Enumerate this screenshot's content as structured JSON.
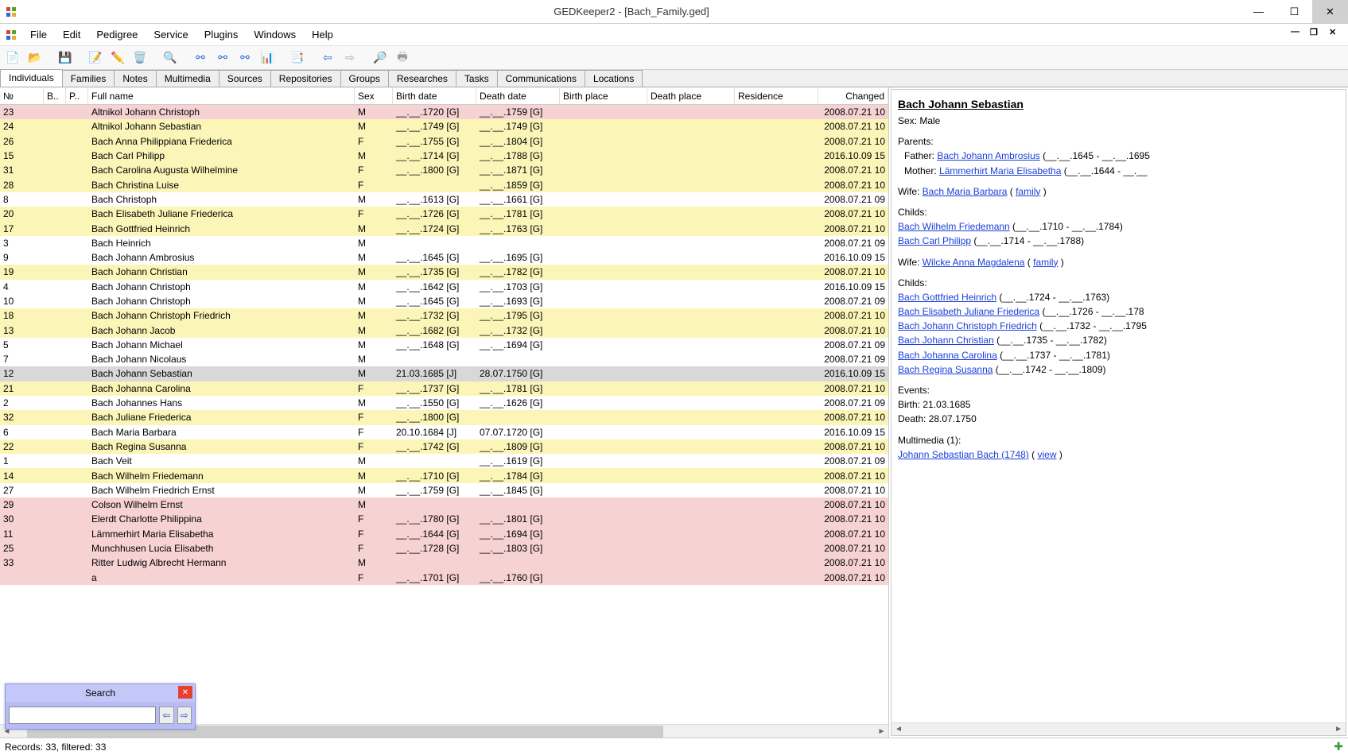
{
  "title": "GEDKeeper2 - [Bach_Family.ged]",
  "menu": [
    "File",
    "Edit",
    "Pedigree",
    "Service",
    "Plugins",
    "Windows",
    "Help"
  ],
  "tabs": [
    "Individuals",
    "Families",
    "Notes",
    "Multimedia",
    "Sources",
    "Repositories",
    "Groups",
    "Researches",
    "Tasks",
    "Communications",
    "Locations"
  ],
  "columns": [
    "№",
    "B..",
    "P..",
    "Full name",
    "Sex",
    "Birth date",
    "Death date",
    "Birth place",
    "Death place",
    "Residence",
    "Changed"
  ],
  "rows": [
    {
      "no": "23",
      "name": "Altnikol Johann Christoph",
      "sex": "M",
      "bd": "__.__.1720 [G]",
      "dd": "__.__.1759 [G]",
      "chg": "2008.07.21 10",
      "cls": "pink"
    },
    {
      "no": "24",
      "name": "Altnikol Johann Sebastian",
      "sex": "M",
      "bd": "__.__.1749 [G]",
      "dd": "__.__.1749 [G]",
      "chg": "2008.07.21 10",
      "cls": "yellow"
    },
    {
      "no": "26",
      "name": "Bach Anna Philippiana Friederica",
      "sex": "F",
      "bd": "__.__.1755 [G]",
      "dd": "__.__.1804 [G]",
      "chg": "2008.07.21 10",
      "cls": "yellow"
    },
    {
      "no": "15",
      "name": "Bach Carl Philipp",
      "sex": "M",
      "bd": "__.__.1714 [G]",
      "dd": "__.__.1788 [G]",
      "chg": "2016.10.09 15",
      "cls": "yellow"
    },
    {
      "no": "31",
      "name": "Bach Carolina Augusta Wilhelmine",
      "sex": "F",
      "bd": "__.__.1800 [G]",
      "dd": "__.__.1871 [G]",
      "chg": "2008.07.21 10",
      "cls": "yellow"
    },
    {
      "no": "28",
      "name": "Bach Christina Luise",
      "sex": "F",
      "bd": "",
      "dd": "__.__.1859 [G]",
      "chg": "2008.07.21 10",
      "cls": "yellow"
    },
    {
      "no": "8",
      "name": "Bach Christoph",
      "sex": "M",
      "bd": "__.__.1613 [G]",
      "dd": "__.__.1661 [G]",
      "chg": "2008.07.21 09",
      "cls": ""
    },
    {
      "no": "20",
      "name": "Bach Elisabeth Juliane Friederica",
      "sex": "F",
      "bd": "__.__.1726 [G]",
      "dd": "__.__.1781 [G]",
      "chg": "2008.07.21 10",
      "cls": "yellow"
    },
    {
      "no": "17",
      "name": "Bach Gottfried Heinrich",
      "sex": "M",
      "bd": "__.__.1724 [G]",
      "dd": "__.__.1763 [G]",
      "chg": "2008.07.21 10",
      "cls": "yellow"
    },
    {
      "no": "3",
      "name": "Bach Heinrich",
      "sex": "M",
      "bd": "",
      "dd": "",
      "chg": "2008.07.21 09",
      "cls": ""
    },
    {
      "no": "9",
      "name": "Bach Johann Ambrosius",
      "sex": "M",
      "bd": "__.__.1645 [G]",
      "dd": "__.__.1695 [G]",
      "chg": "2016.10.09 15",
      "cls": ""
    },
    {
      "no": "19",
      "name": "Bach Johann Christian",
      "sex": "M",
      "bd": "__.__.1735 [G]",
      "dd": "__.__.1782 [G]",
      "chg": "2008.07.21 10",
      "cls": "yellow"
    },
    {
      "no": "4",
      "name": "Bach Johann Christoph",
      "sex": "M",
      "bd": "__.__.1642 [G]",
      "dd": "__.__.1703 [G]",
      "chg": "2016.10.09 15",
      "cls": ""
    },
    {
      "no": "10",
      "name": "Bach Johann Christoph",
      "sex": "M",
      "bd": "__.__.1645 [G]",
      "dd": "__.__.1693 [G]",
      "chg": "2008.07.21 09",
      "cls": ""
    },
    {
      "no": "18",
      "name": "Bach Johann Christoph Friedrich",
      "sex": "M",
      "bd": "__.__.1732 [G]",
      "dd": "__.__.1795 [G]",
      "chg": "2008.07.21 10",
      "cls": "yellow"
    },
    {
      "no": "13",
      "name": "Bach Johann Jacob",
      "sex": "M",
      "bd": "__.__.1682 [G]",
      "dd": "__.__.1732 [G]",
      "chg": "2008.07.21 10",
      "cls": "yellow"
    },
    {
      "no": "5",
      "name": "Bach Johann Michael",
      "sex": "M",
      "bd": "__.__.1648 [G]",
      "dd": "__.__.1694 [G]",
      "chg": "2008.07.21 09",
      "cls": ""
    },
    {
      "no": "7",
      "name": "Bach Johann Nicolaus",
      "sex": "M",
      "bd": "",
      "dd": "",
      "chg": "2008.07.21 09",
      "cls": ""
    },
    {
      "no": "12",
      "name": "Bach Johann Sebastian",
      "sex": "M",
      "bd": "21.03.1685 [J]",
      "dd": "28.07.1750 [G]",
      "chg": "2016.10.09 15",
      "cls": "selected"
    },
    {
      "no": "21",
      "name": "Bach Johanna Carolina",
      "sex": "F",
      "bd": "__.__.1737 [G]",
      "dd": "__.__.1781 [G]",
      "chg": "2008.07.21 10",
      "cls": "yellow"
    },
    {
      "no": "2",
      "name": "Bach Johannes Hans",
      "sex": "M",
      "bd": "__.__.1550 [G]",
      "dd": "__.__.1626 [G]",
      "chg": "2008.07.21 09",
      "cls": ""
    },
    {
      "no": "32",
      "name": "Bach Juliane Friederica",
      "sex": "F",
      "bd": "__.__.1800 [G]",
      "dd": "",
      "chg": "2008.07.21 10",
      "cls": "yellow"
    },
    {
      "no": "6",
      "name": "Bach Maria Barbara",
      "sex": "F",
      "bd": "20.10.1684 [J]",
      "dd": "07.07.1720 [G]",
      "chg": "2016.10.09 15",
      "cls": ""
    },
    {
      "no": "22",
      "name": "Bach Regina Susanna",
      "sex": "F",
      "bd": "__.__.1742 [G]",
      "dd": "__.__.1809 [G]",
      "chg": "2008.07.21 10",
      "cls": "yellow"
    },
    {
      "no": "1",
      "name": "Bach Veit",
      "sex": "M",
      "bd": "",
      "dd": "__.__.1619 [G]",
      "chg": "2008.07.21 09",
      "cls": ""
    },
    {
      "no": "14",
      "name": "Bach Wilhelm Friedemann",
      "sex": "M",
      "bd": "__.__.1710 [G]",
      "dd": "__.__.1784 [G]",
      "chg": "2008.07.21 10",
      "cls": "yellow"
    },
    {
      "no": "27",
      "name": "Bach Wilhelm Friedrich Ernst",
      "sex": "M",
      "bd": "__.__.1759 [G]",
      "dd": "__.__.1845 [G]",
      "chg": "2008.07.21 10",
      "cls": ""
    },
    {
      "no": "29",
      "name": "Colson Wilhelm Ernst",
      "sex": "M",
      "bd": "",
      "dd": "",
      "chg": "2008.07.21 10",
      "cls": "pink"
    },
    {
      "no": "30",
      "name": "Elerdt Charlotte Philippina",
      "sex": "F",
      "bd": "__.__.1780 [G]",
      "dd": "__.__.1801 [G]",
      "chg": "2008.07.21 10",
      "cls": "pink"
    },
    {
      "no": "11",
      "name": "Lämmerhirt Maria Elisabetha",
      "sex": "F",
      "bd": "__.__.1644 [G]",
      "dd": "__.__.1694 [G]",
      "chg": "2008.07.21 10",
      "cls": "pink"
    },
    {
      "no": "25",
      "name": "Munchhusen Lucia Elisabeth",
      "sex": "F",
      "bd": "__.__.1728 [G]",
      "dd": "__.__.1803 [G]",
      "chg": "2008.07.21 10",
      "cls": "pink"
    },
    {
      "no": "33",
      "name": "Ritter Ludwig Albrecht Hermann",
      "sex": "M",
      "bd": "",
      "dd": "",
      "chg": "2008.07.21 10",
      "cls": "pink"
    },
    {
      "no": "",
      "name": "a",
      "sex": "F",
      "bd": "__.__.1701 [G]",
      "dd": "__.__.1760 [G]",
      "chg": "2008.07.21 10",
      "cls": "pink"
    }
  ],
  "detail": {
    "name": "Bach Johann Sebastian",
    "sex": "Sex: Male",
    "parents_label": "Parents:",
    "father_label": "Father: ",
    "father": "Bach Johann Ambrosius",
    "father_dates": "  (__.__.1645 - __.__.1695",
    "mother_label": "Mother: ",
    "mother": "Lämmerhirt Maria Elisabetha",
    "mother_dates": "  (__.__.1644 - __.__",
    "wife1_label": "Wife: ",
    "wife1": "Bach Maria Barbara",
    "family_word": "family",
    "childs_label": "Childs:",
    "childs1": [
      {
        "name": "Bach Wilhelm Friedemann",
        "dates": "(__.__.1710 - __.__.1784)"
      },
      {
        "name": "Bach Carl Philipp",
        "dates": "(__.__.1714 - __.__.1788)"
      }
    ],
    "wife2_label": "Wife: ",
    "wife2": "Wilcke Anna Magdalena",
    "childs2": [
      {
        "name": "Bach Gottfried Heinrich",
        "dates": "(__.__.1724 - __.__.1763)"
      },
      {
        "name": "Bach Elisabeth Juliane Friederica",
        "dates": "(__.__.1726 - __.__.178"
      },
      {
        "name": "Bach Johann Christoph Friedrich",
        "dates": "(__.__.1732 - __.__.1795"
      },
      {
        "name": "Bach Johann Christian",
        "dates": "(__.__.1735 - __.__.1782)"
      },
      {
        "name": "Bach Johanna Carolina",
        "dates": "(__.__.1737 - __.__.1781)"
      },
      {
        "name": "Bach Regina Susanna",
        "dates": "(__.__.1742 - __.__.1809)"
      }
    ],
    "events_label": "Events:",
    "events": [
      "Birth: 21.03.1685",
      "Death: 28.07.1750"
    ],
    "mm_label": "Multimedia (1):",
    "mm_item": "Johann Sebastian Bach (1748)",
    "view_word": "view"
  },
  "search": {
    "title": "Search",
    "value": ""
  },
  "status": "Records: 33, filtered: 33"
}
